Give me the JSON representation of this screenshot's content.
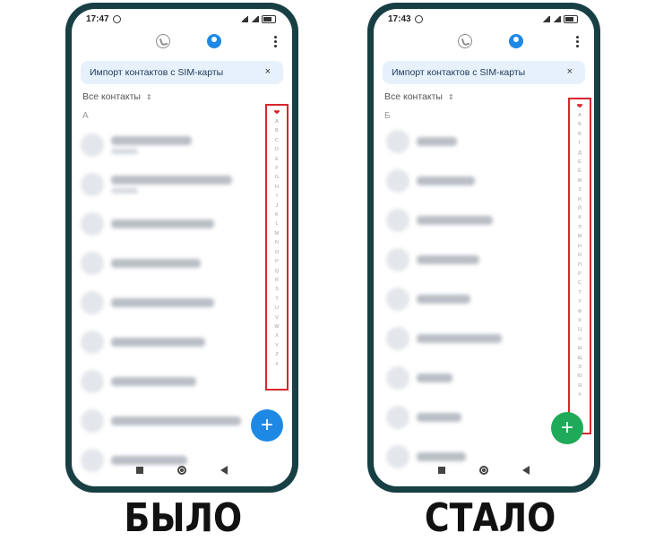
{
  "left_phone": {
    "time": "17:47",
    "banner_text": "Импорт контактов с SIM-карты",
    "banner_close": "×",
    "filter_label": "Все контакты",
    "filter_arrow": "⇕",
    "section_letter": "А",
    "index_heart": "❤",
    "index_letters": [
      "A",
      "B",
      "C",
      "D",
      "E",
      "F",
      "G",
      "H",
      "I",
      "J",
      "K",
      "L",
      "M",
      "N",
      "O",
      "P",
      "Q",
      "R",
      "S",
      "T",
      "U",
      "V",
      "W",
      "X",
      "Y",
      "Z",
      "#"
    ],
    "contacts": [
      {
        "name_width": 90,
        "has_sub": true
      },
      {
        "name_width": 135,
        "has_sub": true
      },
      {
        "name_width": 115,
        "has_sub": false
      },
      {
        "name_width": 100,
        "has_sub": false
      },
      {
        "name_width": 115,
        "has_sub": false
      },
      {
        "name_width": 105,
        "has_sub": false
      },
      {
        "name_width": 95,
        "has_sub": false
      },
      {
        "name_width": 145,
        "has_sub": false
      },
      {
        "name_width": 85,
        "has_sub": false
      }
    ],
    "fab_label": "+",
    "fab_color": "#1e88e5"
  },
  "right_phone": {
    "time": "17:43",
    "banner_text": "Импорт контактов с SIM-карты",
    "banner_close": "×",
    "filter_label": "Все контакты",
    "filter_arrow": "⇕",
    "section_letter": "Б",
    "index_heart": "❤",
    "index_letters": [
      "А",
      "Б",
      "В",
      "Г",
      "Д",
      "Е",
      "Ё",
      "Ж",
      "З",
      "И",
      "Й",
      "К",
      "Л",
      "М",
      "Н",
      "О",
      "П",
      "Р",
      "С",
      "Т",
      "У",
      "Ф",
      "Х",
      "Ц",
      "Ч",
      "Ш",
      "Щ",
      "Э",
      "Ю",
      "Я",
      "#"
    ],
    "contacts": [
      {
        "name_width": 45,
        "has_sub": false
      },
      {
        "name_width": 65,
        "has_sub": false
      },
      {
        "name_width": 85,
        "has_sub": false
      },
      {
        "name_width": 70,
        "has_sub": false
      },
      {
        "name_width": 60,
        "has_sub": false
      },
      {
        "name_width": 95,
        "has_sub": false
      },
      {
        "name_width": 40,
        "has_sub": false
      },
      {
        "name_width": 50,
        "has_sub": false
      },
      {
        "name_width": 55,
        "has_sub": false
      }
    ],
    "fab_label": "+",
    "fab_color": "#1faa59"
  },
  "captions": {
    "before": "БЫЛО",
    "after": "СТАЛО"
  },
  "colors": {
    "highlight_border": "#d9262d",
    "phone_frame": "#173f44",
    "banner_bg": "#e7f1fb",
    "contacts_tab": "#1e88e5"
  }
}
